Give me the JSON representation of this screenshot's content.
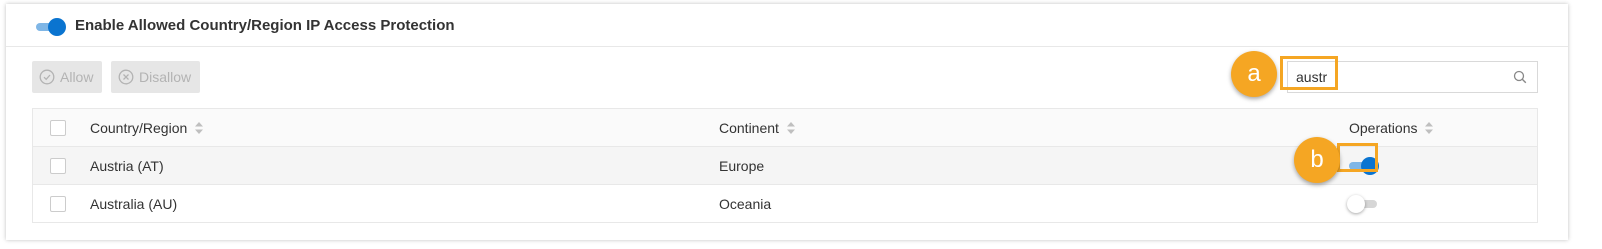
{
  "header": {
    "toggle_state": "on",
    "title": "Enable Allowed Country/Region IP Access Protection"
  },
  "toolbar": {
    "allow_label": "Allow",
    "disallow_label": "Disallow"
  },
  "search": {
    "value": "austr",
    "placeholder": ""
  },
  "markers": {
    "a": "a",
    "b": "b"
  },
  "table": {
    "columns": [
      "Country/Region",
      "Continent",
      "Operations"
    ],
    "rows": [
      {
        "country": "Austria (AT)",
        "continent": "Europe",
        "enabled": true
      },
      {
        "country": "Australia (AU)",
        "continent": "Oceania",
        "enabled": false
      }
    ]
  },
  "colors": {
    "accent": "#0a74d0",
    "highlight": "#f5a623"
  }
}
